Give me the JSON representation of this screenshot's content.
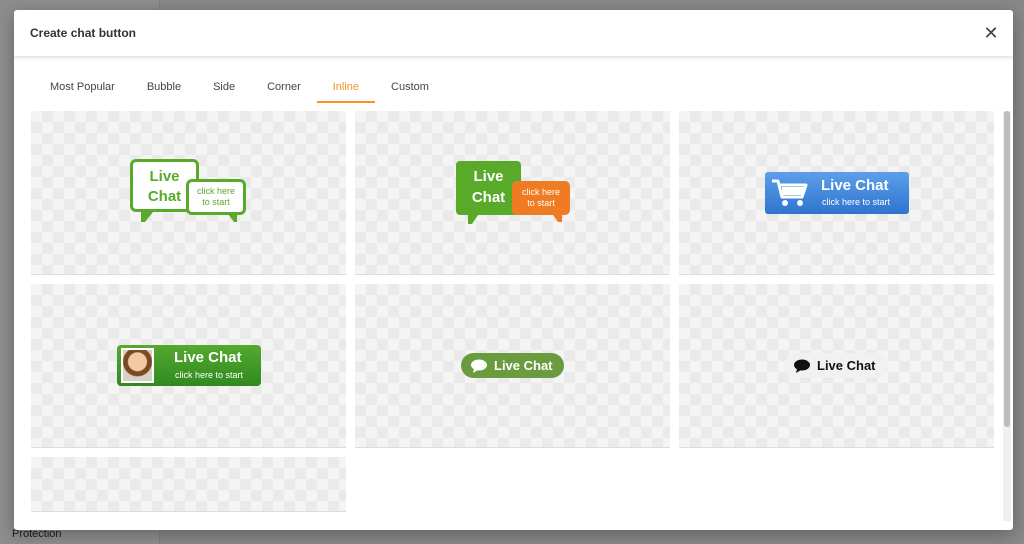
{
  "background": {
    "bottom_label": "Protection"
  },
  "modal": {
    "title": "Create chat button",
    "close_glyph": "✕"
  },
  "tabs": [
    {
      "label": "Most Popular",
      "active": false
    },
    {
      "label": "Bubble",
      "active": false
    },
    {
      "label": "Side",
      "active": false
    },
    {
      "label": "Corner",
      "active": false
    },
    {
      "label": "Inline",
      "active": true
    },
    {
      "label": "Custom",
      "active": false
    }
  ],
  "buttons": [
    {
      "line1": "Live",
      "line2": "Chat",
      "sub1": "click here",
      "sub2": "to start",
      "style": "outline-bubbles"
    },
    {
      "line1": "Live",
      "line2": "Chat",
      "sub1": "click here",
      "sub2": "to start",
      "style": "filled-bubbles"
    },
    {
      "title": "Live Chat",
      "sub": "click here to start",
      "icon": "cart-icon",
      "style": "blue-cart"
    },
    {
      "title": "Live Chat",
      "sub": "click here to start",
      "icon": "avatar",
      "style": "green-avatar"
    },
    {
      "title": "Live Chat",
      "icon": "speech-bubble-icon",
      "style": "green-pill"
    },
    {
      "title": "Live Chat",
      "icon": "speech-bubble-icon",
      "style": "light-pill"
    }
  ],
  "colors": {
    "accent": "#f7931e",
    "green": "#5aaa2a",
    "orange": "#ef7b22",
    "blue": "#2f74cf"
  }
}
